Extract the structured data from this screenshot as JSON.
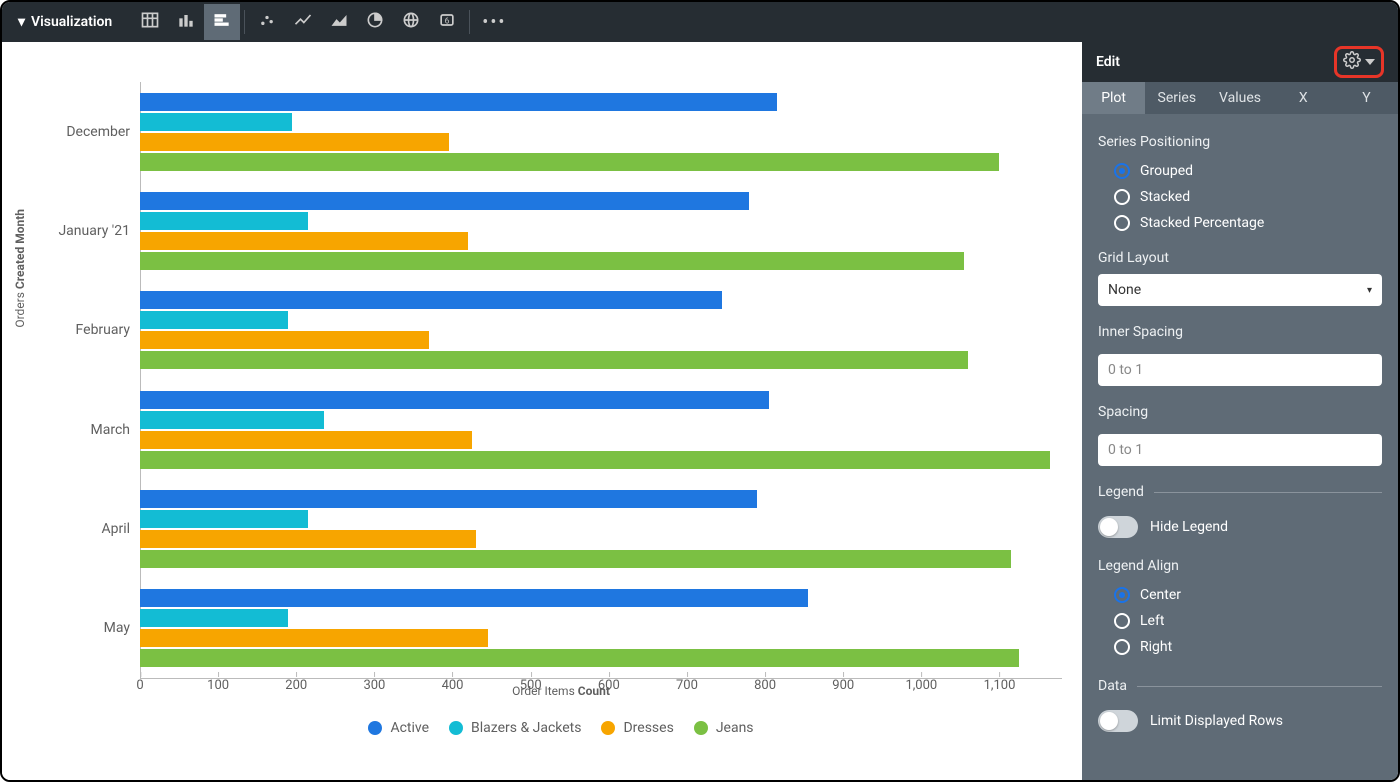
{
  "toolbar": {
    "title": "Visualization",
    "icons": [
      {
        "name": "table-icon"
      },
      {
        "name": "column-chart-icon"
      },
      {
        "name": "bar-chart-icon",
        "selected": true
      },
      {
        "name": "scatter-chart-icon"
      },
      {
        "name": "line-chart-icon"
      },
      {
        "name": "area-chart-icon"
      },
      {
        "name": "pie-chart-icon"
      },
      {
        "name": "map-icon"
      },
      {
        "name": "single-value-icon"
      }
    ]
  },
  "edit": {
    "title": "Edit",
    "tabs": [
      "Plot",
      "Series",
      "Values",
      "X",
      "Y"
    ],
    "active_tab": 0,
    "series_positioning": {
      "label": "Series Positioning",
      "options": [
        "Grouped",
        "Stacked",
        "Stacked Percentage"
      ],
      "selected": 0
    },
    "grid_layout": {
      "label": "Grid Layout",
      "value": "None"
    },
    "inner_spacing": {
      "label": "Inner Spacing",
      "placeholder": "0 to 1",
      "value": ""
    },
    "spacing": {
      "label": "Spacing",
      "placeholder": "0 to 1",
      "value": ""
    },
    "legend_section": {
      "label": "Legend",
      "hide_label": "Hide Legend",
      "hide_value": false
    },
    "legend_align": {
      "label": "Legend Align",
      "options": [
        "Center",
        "Left",
        "Right"
      ],
      "selected": 0
    },
    "data_section": {
      "label": "Data",
      "limit_label": "Limit Displayed Rows",
      "limit_value": false
    }
  },
  "chart_data": {
    "type": "bar",
    "orientation": "horizontal",
    "y_axis_title_prefix": "Orders ",
    "y_axis_title_bold": "Created Month",
    "x_axis_title_prefix": "Order Items ",
    "x_axis_title_bold": "Count",
    "categories": [
      "December",
      "January '21",
      "February",
      "March",
      "April",
      "May"
    ],
    "series": [
      {
        "name": "Active",
        "color": "#1f77e0",
        "values": [
          815,
          780,
          745,
          805,
          790,
          855
        ]
      },
      {
        "name": "Blazers & Jackets",
        "color": "#13bcd4",
        "values": [
          195,
          215,
          190,
          235,
          215,
          190
        ]
      },
      {
        "name": "Dresses",
        "color": "#f7a500",
        "values": [
          395,
          420,
          370,
          425,
          430,
          445
        ]
      },
      {
        "name": "Jeans",
        "color": "#7bc043",
        "values": [
          1100,
          1055,
          1060,
          1165,
          1115,
          1125
        ]
      }
    ],
    "x_ticks": [
      0,
      100,
      200,
      300,
      400,
      500,
      600,
      700,
      800,
      900,
      1000,
      1100
    ],
    "x_tick_labels": [
      "0",
      "100",
      "200",
      "300",
      "400",
      "500",
      "600",
      "700",
      "800",
      "900",
      "1,000",
      "1,100"
    ],
    "x_max": 1180
  }
}
